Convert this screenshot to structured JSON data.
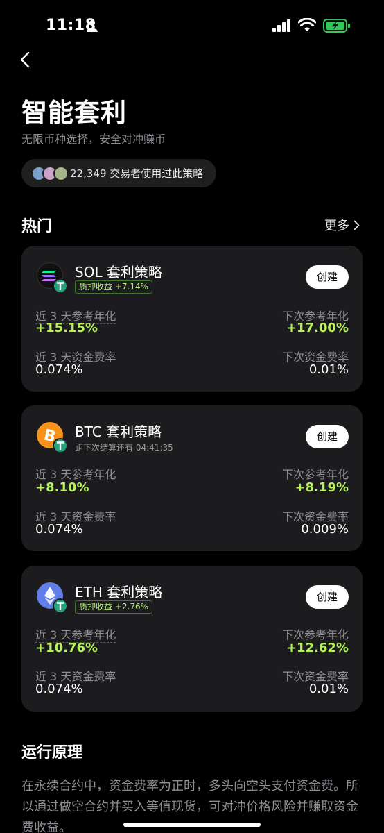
{
  "status": {
    "time": "11:18"
  },
  "header": {
    "title": "智能套利",
    "subtitle": "无限币种选择，安全对冲赚币",
    "users_text": "22,349 交易者使用过此策略"
  },
  "hot": {
    "title": "热门",
    "more_label": "更多"
  },
  "cards": [
    {
      "name": "SOL 套利策略",
      "tag": "质押收益 +7.14%",
      "create_label": "创建",
      "label_tl": "近 3 天参考年化",
      "value_tl": "+15.15%",
      "label_tr": "下次参考年化",
      "value_tr": "+17.00%",
      "label_bl": "近 3 天资金费率",
      "value_bl": "0.074%",
      "label_br": "下次资金费率",
      "value_br": "0.01%"
    },
    {
      "name": "BTC 套利策略",
      "tag": "距下次结算还有  04:41:35",
      "create_label": "创建",
      "label_tl": "近 3 天参考年化",
      "value_tl": "+8.10%",
      "label_tr": "下次参考年化",
      "value_tr": "+8.19%",
      "label_bl": "近 3 天资金费率",
      "value_bl": "0.074%",
      "label_br": "下次资金费率",
      "value_br": "0.009%"
    },
    {
      "name": "ETH 套利策略",
      "tag": "质押收益 +2.76%",
      "create_label": "创建",
      "label_tl": "近 3 天参考年化",
      "value_tl": "+10.76%",
      "label_tr": "下次参考年化",
      "value_tr": "+12.62%",
      "label_bl": "近 3 天资金费率",
      "value_bl": "0.074%",
      "label_br": "下次资金费率",
      "value_br": "0.01%"
    }
  ],
  "principle": {
    "title": "运行原理",
    "text": "在永续合约中，资金费率为正时，多头向空头支付资金费。所以通过做空合约并买入等值现货，可对冲价格风险并赚取资金费收益。"
  },
  "colors": {
    "accent_green": "#b6f25a",
    "card_bg": "#1c1c1e",
    "btc": "#f7931a",
    "eth": "#627eea",
    "usdt": "#26a17b"
  }
}
